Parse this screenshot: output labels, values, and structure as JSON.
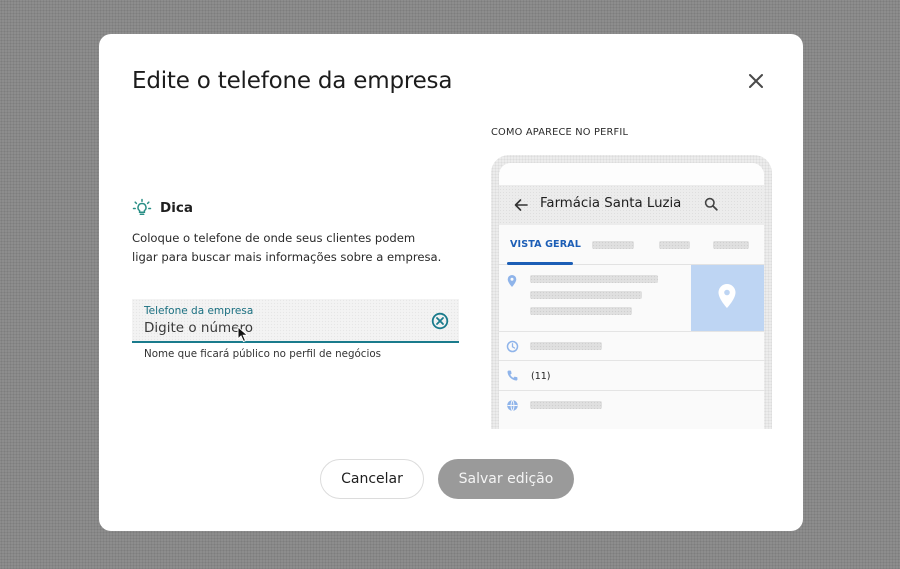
{
  "dialog": {
    "title": "Edite o telefone da empresa",
    "close_icon": "close-icon"
  },
  "tip": {
    "icon": "lightbulb-icon",
    "title": "Dica",
    "text": "Coloque o telefone de onde seus clientes podem ligar para buscar mais informações sobre a empresa."
  },
  "phone_field": {
    "label": "Telefone da empresa",
    "placeholder": "Digite o número",
    "value": "",
    "helper": "Nome que ficará público no perfil de negócios",
    "clear_icon": "clear-circle-icon",
    "accent_color": "#1a7b8c"
  },
  "preview": {
    "caption": "COMO APARECE NO PERFIL",
    "business_name": "Farmácia Santa Luzia",
    "active_tab": "VISTA GERAL",
    "phone_number": "(11)",
    "tab_color": "#1c5eb6",
    "map_color": "#bed5f3"
  },
  "actions": {
    "cancel_label": "Cancelar",
    "save_label": "Salvar edição"
  }
}
